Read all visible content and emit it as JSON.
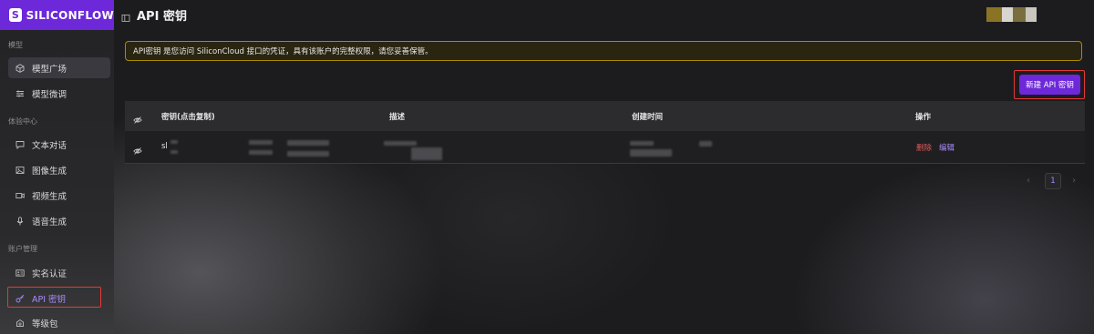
{
  "brand": {
    "name": "SILICONFLOW",
    "logo_letter": "S",
    "color": "#6d28d9"
  },
  "header": {
    "title": "API 密钥"
  },
  "sidebar": {
    "sections": [
      {
        "title": "模型",
        "items": [
          {
            "label": "模型广场",
            "icon": "cube-icon"
          },
          {
            "label": "模型微调",
            "icon": "sliders-icon"
          }
        ]
      },
      {
        "title": "体验中心",
        "items": [
          {
            "label": "文本对话",
            "icon": "chat-icon"
          },
          {
            "label": "图像生成",
            "icon": "image-icon"
          },
          {
            "label": "视频生成",
            "icon": "video-icon"
          },
          {
            "label": "语音生成",
            "icon": "mic-icon"
          }
        ]
      },
      {
        "title": "账户管理",
        "items": [
          {
            "label": "实名认证",
            "icon": "id-card-icon"
          },
          {
            "label": "API 密钥",
            "icon": "key-icon"
          },
          {
            "label": "等级包",
            "icon": "package-icon"
          }
        ]
      }
    ]
  },
  "notice": {
    "text": "API密钥 是您访问 SiliconCloud 接口的凭证，具有该账户的完整权限，请您妥善保管。"
  },
  "toolbar": {
    "new_key_label": "新建 API 密钥"
  },
  "table": {
    "headers": [
      "密钥(点击复制)",
      "描述",
      "创建时间",
      "操作"
    ],
    "rows": [
      {
        "key": "sl",
        "actions": {
          "delete": "删除",
          "edit": "编辑"
        }
      }
    ]
  },
  "pagination": {
    "prev": "‹",
    "current": "1",
    "next": "›"
  },
  "colors": {
    "accent": "#6d28d9",
    "accent_text": "#a78bfa",
    "danger": "#e05a5a",
    "notice_border": "#a78b00",
    "highlight_box": "#e53935"
  }
}
